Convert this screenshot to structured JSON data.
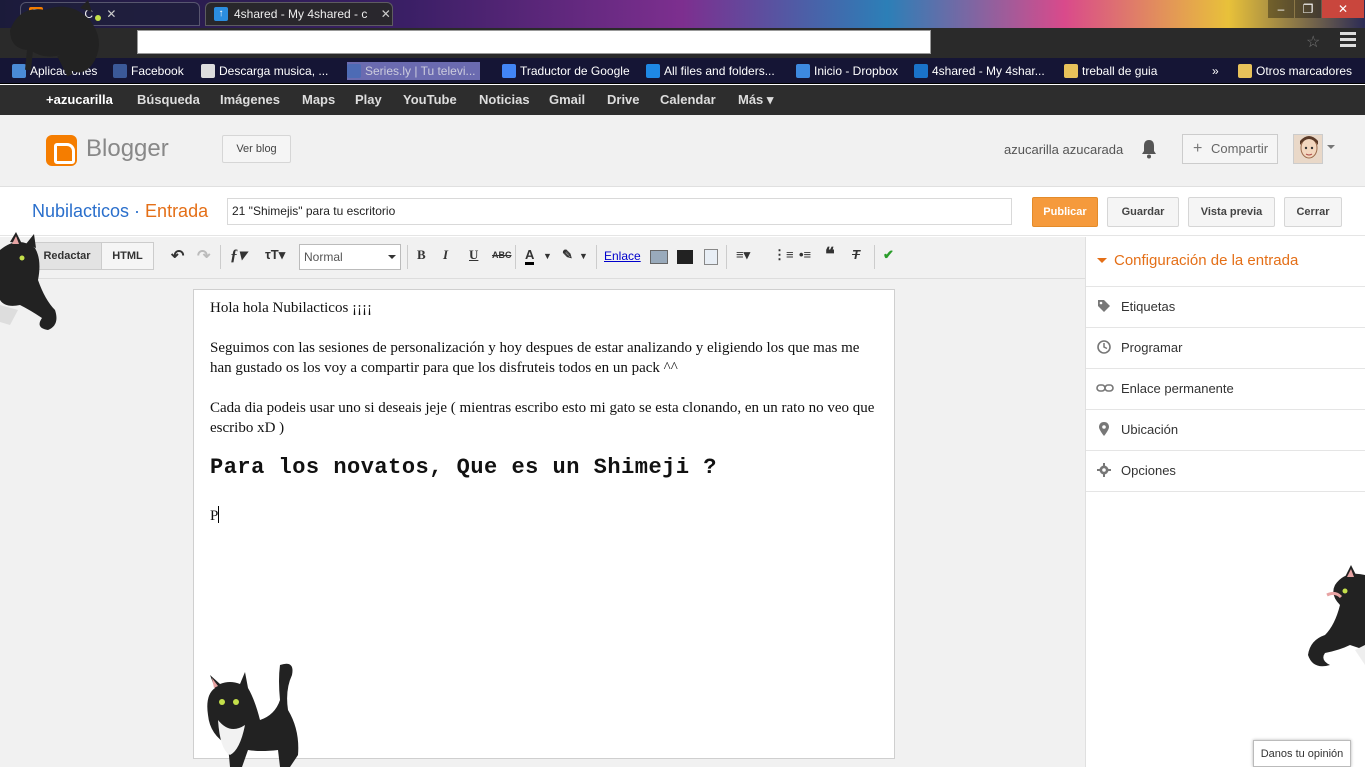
{
  "browser": {
    "tabs": [
      {
        "label": "ticos - C"
      },
      {
        "label": "4shared - My 4shared - c"
      }
    ],
    "address_value": "",
    "bookmarks": [
      {
        "label": "Aplicaciones"
      },
      {
        "label": "Facebook"
      },
      {
        "label": "Descarga musica, ..."
      },
      {
        "label": "Series.ly | Tu televi..."
      },
      {
        "label": "Traductor de Google"
      },
      {
        "label": "All files and folders..."
      },
      {
        "label": "Inicio - Dropbox"
      },
      {
        "label": "4shared - My 4shar..."
      },
      {
        "label": "treball de guia"
      },
      {
        "label": "»"
      },
      {
        "label": "Otros marcadores"
      }
    ]
  },
  "google_bar": {
    "items": [
      "+azucarilla",
      "Búsqueda",
      "Imágenes",
      "Maps",
      "Play",
      "YouTube",
      "Noticias",
      "Gmail",
      "Drive",
      "Calendar",
      "Más ▾"
    ]
  },
  "header": {
    "logo_text": "Blogger",
    "view_blog": "Ver blog",
    "user_name": "azucarilla azucarada",
    "share_label": "Compartir"
  },
  "post": {
    "blog_name": "Nubilacticos",
    "separator": " · ",
    "section": "Entrada",
    "title_value": "21 \"Shimejis\" para tu escritorio",
    "buttons": {
      "publish": "Publicar",
      "save": "Guardar",
      "preview": "Vista previa",
      "close": "Cerrar"
    }
  },
  "editor": {
    "modes": [
      "Redactar",
      "HTML"
    ],
    "format_value": "Normal",
    "link_label": "Enlace",
    "content": {
      "p1": "Hola hola Nubilacticos ¡¡¡¡",
      "p2": "Seguimos con las sesiones de personalización y hoy despues de estar analizando y eligiendo los que mas me han gustado os los voy a compartir para que los disfruteis todos en un pack ^^",
      "p3": "Cada dia podeis usar uno si deseais jeje ( mientras escribo esto mi gato se esta clonando, en un rato no veo que escribo xD )",
      "heading": "Para los novatos, Que es un Shimeji ?",
      "p4": "P"
    }
  },
  "settings_panel": {
    "title": "Configuración de la entrada",
    "items": [
      "Etiquetas",
      "Programar",
      "Enlace permanente",
      "Ubicación",
      "Opciones"
    ]
  },
  "feedback": "Danos tu opinión",
  "colors": {
    "blogger_orange": "#f57d00",
    "link_blue": "#2a6fcc",
    "publish": "#f59a3c"
  }
}
